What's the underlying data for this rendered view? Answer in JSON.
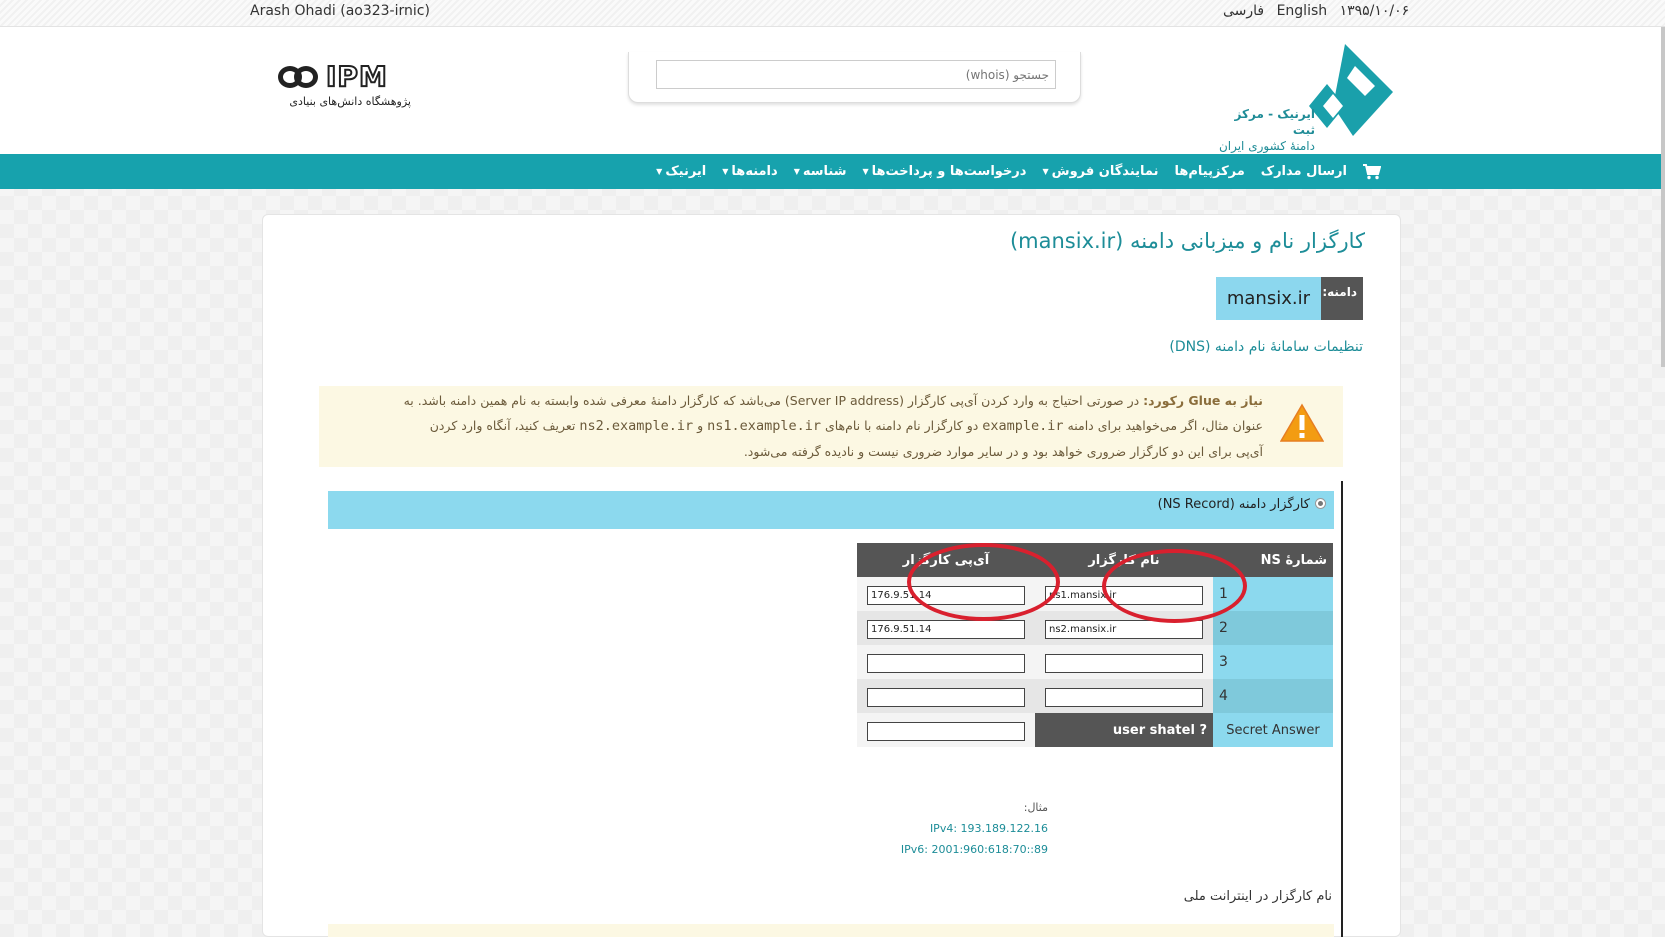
{
  "topbar": {
    "user": "Arash Ohadi (ao323-irnic)",
    "lang_fa": "فارسی",
    "lang_en": "English",
    "date": "۱۳۹۵/۱۰/۰۶"
  },
  "header": {
    "ipm_logo_text": "IPM",
    "ipm_subtitle": "پژوهشگاه دانش‌های بنیادی",
    "search_placeholder": "جستجو (whois)",
    "irnic_name": "ایرنیک - مرکز ثبت",
    "irnic_sub": "دامنهٔ کشوری ایران"
  },
  "nav": {
    "items": [
      {
        "label": "ایرنیک",
        "dropdown": true
      },
      {
        "label": "دامنه‌ها",
        "dropdown": true
      },
      {
        "label": "شناسه",
        "dropdown": true
      },
      {
        "label": "درخواست‌ها و پرداخت‌ها",
        "dropdown": true
      },
      {
        "label": "نمایندگان فروش",
        "dropdown": true
      },
      {
        "label": "مرکزپیام‌ها",
        "dropdown": false
      },
      {
        "label": "ارسال مدارک",
        "dropdown": false
      }
    ],
    "cart_icon": "shopping-cart-icon"
  },
  "main": {
    "title": "کارگزار نام و میزبانی دامنه (mansix.ir)",
    "domain_label": "دامنه:",
    "domain_value": "mansix.ir",
    "dns_heading": "تنظیمات سامانهٔ نام دامنه (DNS)",
    "warning": {
      "icon": "warning-triangle-icon",
      "bold": "نیاز به Glue رکورد:",
      "line1": " در صورتی احتیاج به وارد کردن آی‌پی کارگزار (Server IP address) می‌باشد که کارگزار دامنهٔ معرفی شده وابسته به نام همین دامنه باشد. به",
      "line2_a": "عنوان مثال، اگر می‌خواهید برای دامنه ",
      "line2_mono1": "example.ir",
      "line2_b": " دو کارگزار نام دامنه با نام‌های ",
      "line2_mono2": "ns1.example.ir",
      "line2_c": " و ",
      "line2_mono3": "ns2.example.ir",
      "line2_d": " تعریف کنید، آنگاه وارد کردن",
      "line3": "آی‌پی برای این دو کارگزار ضروری خواهد بود و در سایر موارد ضروری نیست و نادیده گرفته می‌شود."
    },
    "ns_option": "کارگزار دامنه (NS Record)",
    "table": {
      "col_num": "شمارهٔ NS",
      "col_name": "نام کارگزار",
      "col_ip": "آی‌پی کارگزار",
      "rows": [
        {
          "num": "1",
          "name": "ns1.mansix.ir",
          "ip": "176.9.51.14"
        },
        {
          "num": "2",
          "name": "ns2.mansix.ir",
          "ip": "176.9.51.14"
        },
        {
          "num": "3",
          "name": "",
          "ip": ""
        },
        {
          "num": "4",
          "name": "",
          "ip": ""
        }
      ],
      "secret_label": "Secret Answer",
      "secret_question": "user shatel ?"
    },
    "example_label": "مثال:",
    "example_ipv4": "IPv4: 193.189.122.16",
    "example_ipv6": "IPv6: 2001:960:618:70::89",
    "national_heading": "نام کارگزار در اینترانت ملی"
  },
  "colors": {
    "nav_teal": "#17a2ad",
    "light_blue": "#8cd9ee",
    "annotation_red": "#d9202e",
    "warning_bg": "#fcf8e3"
  }
}
